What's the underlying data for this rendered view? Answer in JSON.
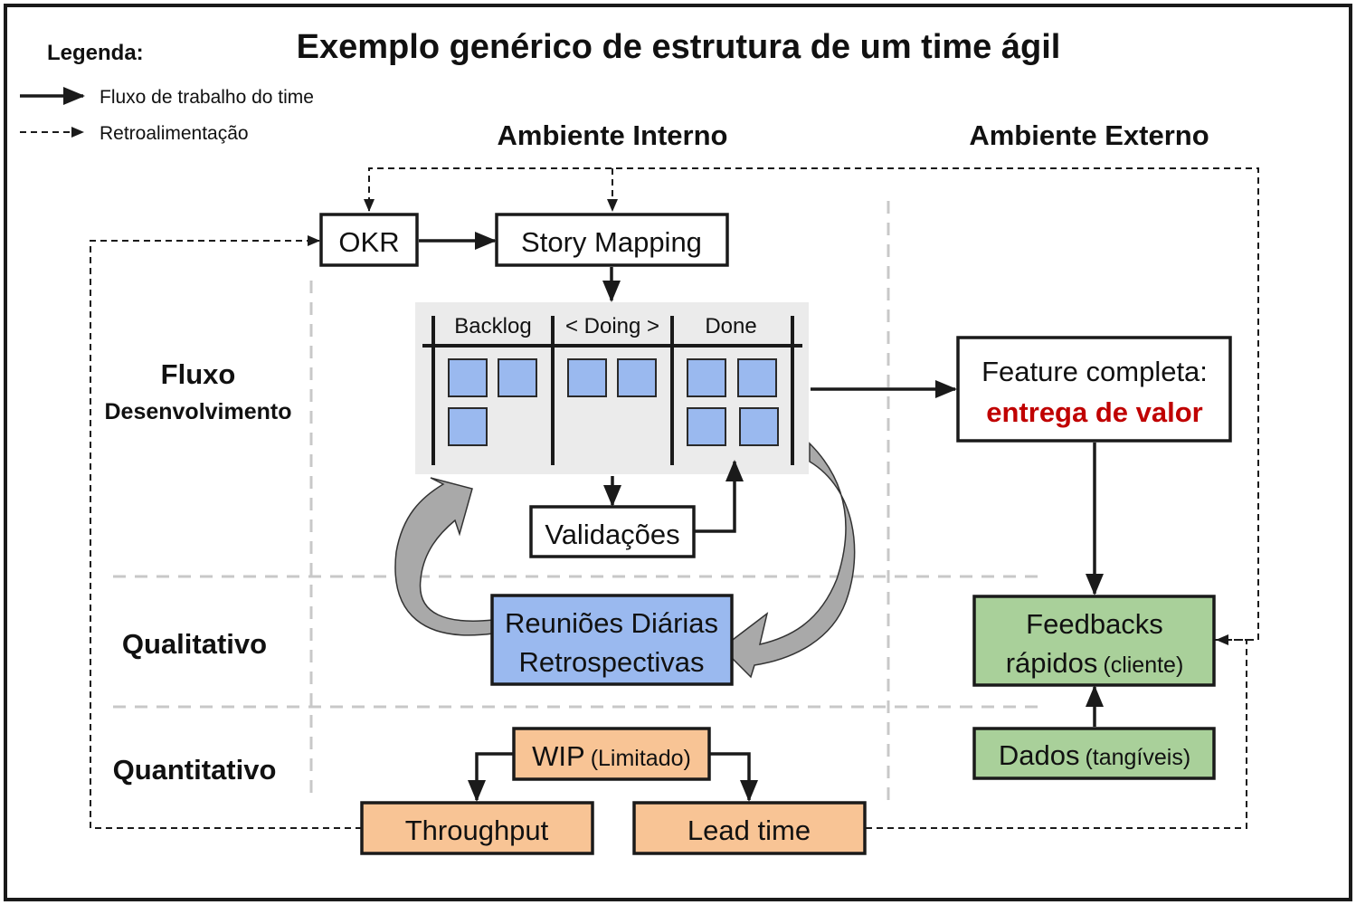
{
  "title": "Exemplo genérico de estrutura de um time ágil",
  "legend": {
    "heading": "Legenda:",
    "items": [
      {
        "icon": "solid-arrow-icon",
        "label": "Fluxo de trabalho do time"
      },
      {
        "icon": "dashed-arrow-icon",
        "label": "Retroalimentação"
      }
    ]
  },
  "sections": {
    "internal": "Ambiente Interno",
    "external": "Ambiente Externo"
  },
  "rows": {
    "flow_line1": "Fluxo",
    "flow_line2": "Desenvolvimento",
    "qualitative": "Qualitativo",
    "quantitative": "Quantitativo"
  },
  "nodes": {
    "okr": "OKR",
    "story_mapping": "Story Mapping",
    "kanban": {
      "columns": [
        "Backlog",
        "< Doing >",
        "Done"
      ],
      "card_counts": [
        3,
        2,
        4
      ]
    },
    "validacoes": "Validações",
    "feature": {
      "line1": "Feature completa:",
      "line2": "entrega de valor"
    },
    "reunioes": {
      "line1": "Reuniões Diárias",
      "line2": "Retrospectivas"
    },
    "feedbacks": {
      "line1": "Feedbacks",
      "line2_main": "rápidos",
      "line2_note": "(cliente)"
    },
    "dados": {
      "main": "Dados",
      "note": "(tangíveis)"
    },
    "wip": {
      "main": "WIP",
      "note": "(Limitado)"
    },
    "throughput": "Throughput",
    "lead_time": "Lead time"
  },
  "colors": {
    "accent_red": "#c00000",
    "blue_fill": "#9ab9ef",
    "green_fill": "#a9d09a",
    "orange_fill": "#f8c495",
    "kanban_bg": "#ebebeb",
    "grid_gray": "#c8c8c8"
  }
}
